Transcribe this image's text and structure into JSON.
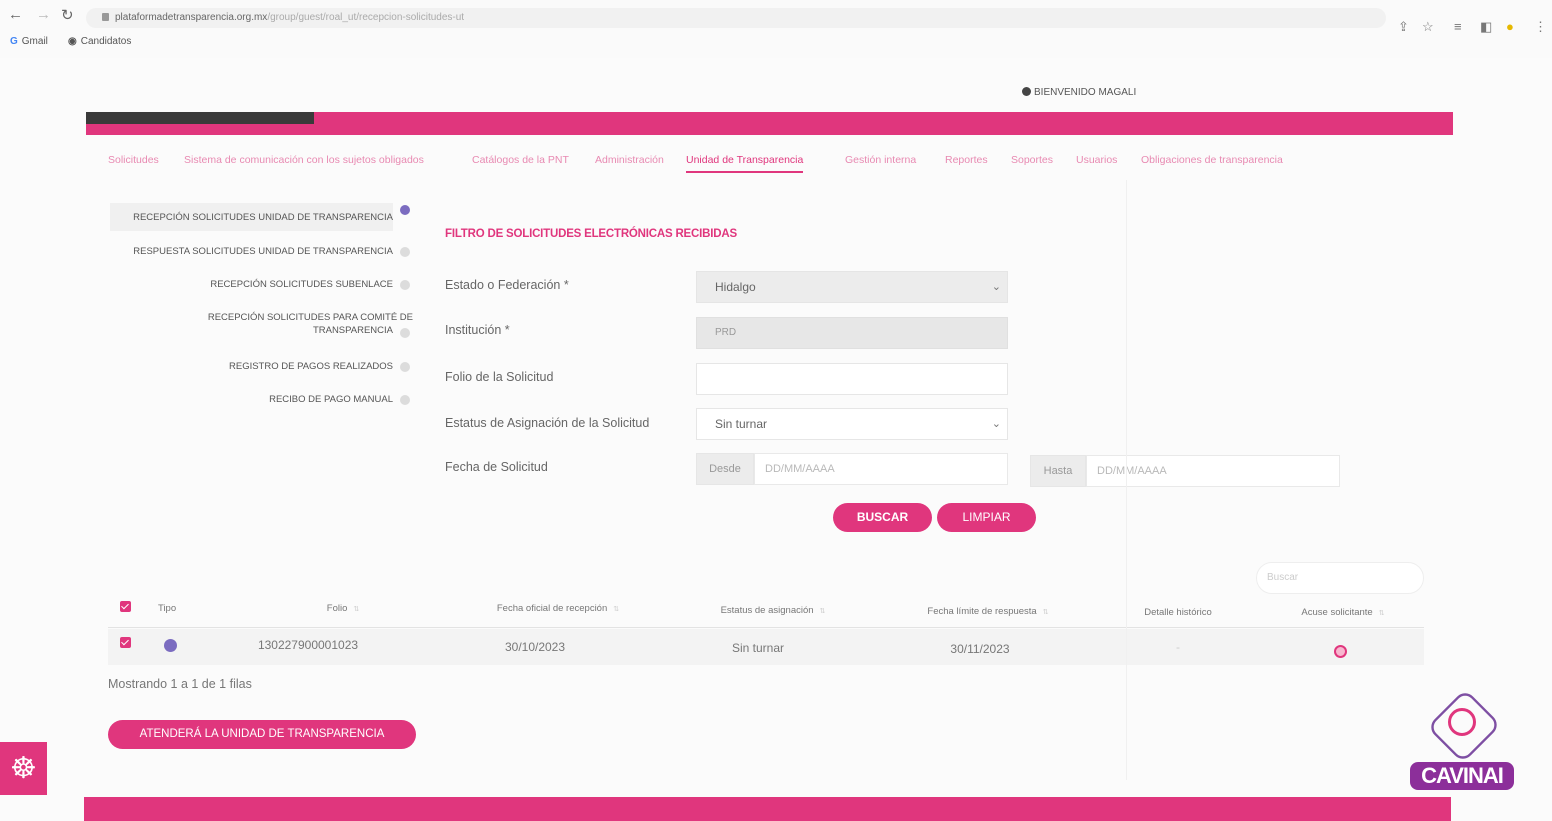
{
  "browser": {
    "url_domain": "plataformadetransparencia.org.mx",
    "url_path": "/group/guest/roal_ut/recepcion-solicitudes-ut",
    "bookmarks": [
      {
        "label": "Gmail",
        "icon": "google-icon"
      },
      {
        "label": "Candidatos",
        "icon": "globe-icon"
      }
    ]
  },
  "header": {
    "welcome": "BIENVENIDO MAGALI"
  },
  "menu": [
    {
      "label": "Solicitudes"
    },
    {
      "label": "Sistema de comunicación con los sujetos obligados"
    },
    {
      "label": "Catálogos de la PNT"
    },
    {
      "label": "Administración"
    },
    {
      "label": "Unidad de Transparencia",
      "active": true
    },
    {
      "label": "Gestión interna"
    },
    {
      "label": "Reportes"
    },
    {
      "label": "Soportes"
    },
    {
      "label": "Usuarios"
    },
    {
      "label": "Obligaciones de transparencia"
    }
  ],
  "sidebar": [
    {
      "label": "RECEPCIÓN SOLICITUDES UNIDAD DE TRANSPARENCIA",
      "active": true
    },
    {
      "label": "RESPUESTA SOLICITUDES UNIDAD DE TRANSPARENCIA"
    },
    {
      "label": "RECEPCIÓN SOLICITUDES SUBENLACE"
    },
    {
      "label_line1": "RECEPCIÓN SOLICITUDES PARA COMITÉ DE",
      "label_line2": "TRANSPARENCIA"
    },
    {
      "label": "REGISTRO DE PAGOS REALIZADOS"
    },
    {
      "label": "RECIBO DE PAGO MANUAL"
    }
  ],
  "filter": {
    "title": "FILTRO DE SOLICITUDES ELECTRÓNICAS RECIBIDAS",
    "estado_label": "Estado o Federación *",
    "estado_value": "Hidalgo",
    "institucion_label": "Institución *",
    "institucion_value": "PRD",
    "folio_label": "Folio de la Solicitud",
    "folio_value": "",
    "estatus_label": "Estatus de Asignación de la Solicitud",
    "estatus_value": "Sin turnar",
    "fecha_label": "Fecha de Solicitud",
    "desde_label": "Desde",
    "desde_placeholder": "DD/MM/AAAA",
    "hasta_label": "Hasta",
    "hasta_placeholder": "DD/MM/AAAA",
    "buscar_button": "BUSCAR",
    "limpiar_button": "LIMPIAR"
  },
  "table": {
    "search_placeholder": "Buscar",
    "columns": [
      "Tipo",
      "Folio",
      "Fecha oficial de recepción",
      "Estatus de asignación",
      "Fecha límite de respuesta",
      "Detalle histórico",
      "Acuse solicitante"
    ],
    "rows": [
      {
        "folio": "130227900001023",
        "fecha_recepcion": "30/10/2023",
        "estatus": "Sin turnar",
        "fecha_limite": "30/11/2023",
        "detalle": "-"
      }
    ],
    "showing": "Mostrando 1 a 1 de 1 filas"
  },
  "actions": {
    "attend_button": "ATENDERÁ LA UNIDAD DE TRANSPARENCIA"
  },
  "brand": {
    "cavinai_label": "CAVINAI",
    "accent_color": "#e0367d"
  }
}
